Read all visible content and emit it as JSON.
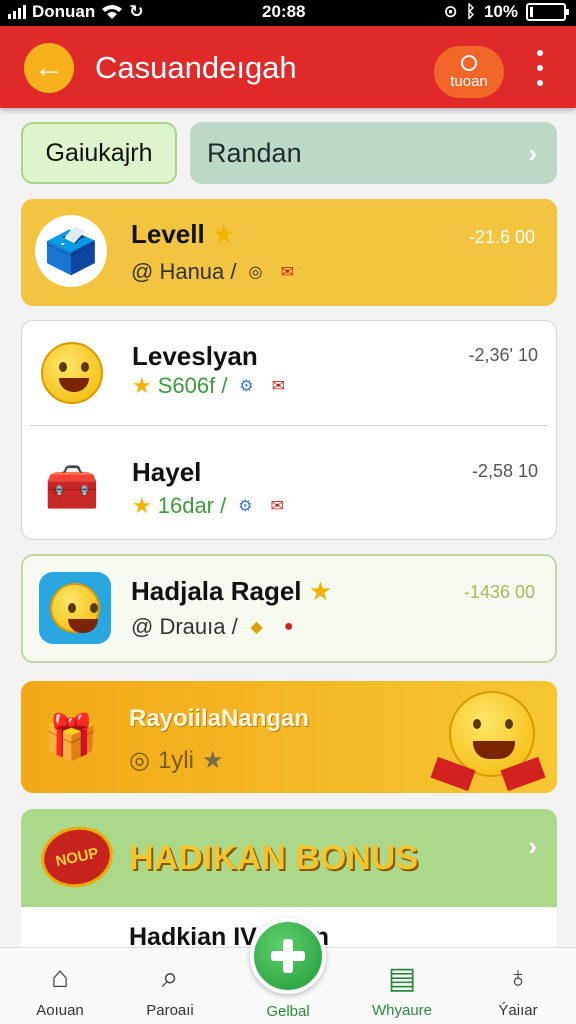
{
  "status_bar": {
    "carrier": "Donuan",
    "time": "20:88",
    "battery": "10%",
    "battery_level": 0.1
  },
  "header": {
    "title": "Casuandeıgah",
    "badge_label": "tuoan"
  },
  "filters": {
    "chip_label": "Gaiukajrh",
    "search_value": "Randan"
  },
  "rows": [
    {
      "title": "Levell",
      "subtitle": "@ Hanua /",
      "value": "-21.6 00"
    },
    {
      "title": "Leveslyan",
      "subtitle": "S606f /",
      "value": "-2,36' 10"
    },
    {
      "title": "Hayel",
      "subtitle": "16dar /",
      "value": "-2,58 10"
    },
    {
      "title": "Hadjala Ragel",
      "subtitle": "@ Drauıa /",
      "value": "-1436 00"
    }
  ],
  "promo": {
    "title": "RayoiilaNangan",
    "subtitle": "1yli"
  },
  "bonus": {
    "badge": "NOUP",
    "title": "HADIKAN BONUS",
    "row_title": "Hadkian IV  dalan"
  },
  "nav": {
    "items": [
      {
        "label": "Aoıuan",
        "icon": "home-icon"
      },
      {
        "label": "Paroaıi",
        "icon": "magnifier-icon"
      },
      {
        "label": "Gelbal",
        "icon": "plus-icon"
      },
      {
        "label": "Whyaure",
        "icon": "wallet-icon"
      },
      {
        "label": "Ýaiıar",
        "icon": "bell-icon"
      }
    ]
  },
  "colors": {
    "header_red": "#e02a2a",
    "accent_yellow": "#f3c43f",
    "accent_green": "#acd88a",
    "nav_green": "#2b8a3a"
  }
}
